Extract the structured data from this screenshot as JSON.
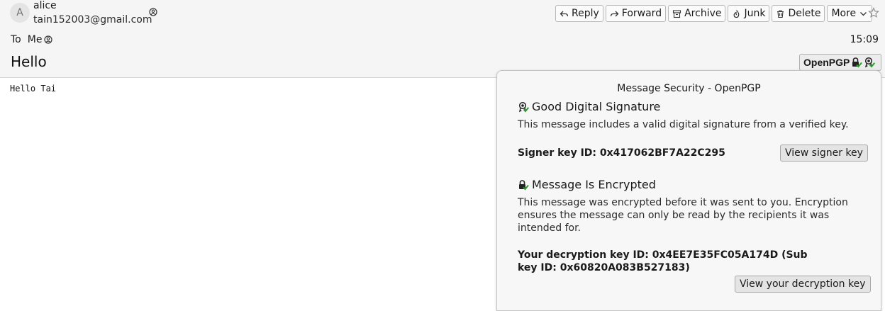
{
  "sender": {
    "avatar_letter": "A",
    "name": "alice",
    "email": "tain152003@gmail.com"
  },
  "toolbar": {
    "reply": "Reply",
    "forward": "Forward",
    "archive": "Archive",
    "junk": "Junk",
    "delete": "Delete",
    "more": "More"
  },
  "recipients": {
    "to_label": "To",
    "me": "Me"
  },
  "message": {
    "time": "15:09",
    "subject": "Hello",
    "body": "Hello Tai"
  },
  "security_button": {
    "label": "OpenPGP"
  },
  "security_popup": {
    "title": "Message Security - OpenPGP",
    "signature": {
      "heading": "Good Digital Signature",
      "description": "This message includes a valid digital signature from a verified key.",
      "key_line": "Signer key ID: 0x417062BF7A22C295",
      "button": "View signer key"
    },
    "encryption": {
      "heading": "Message Is Encrypted",
      "description": "This message was encrypted before it was sent to you. Encryption ensures the message can only be read by the recipients it was intended for.",
      "key_line": "Your decryption key ID: 0x4EE7E35FC05A174D (Sub key ID: 0x60820A083B527183)",
      "button": "View your decryption key"
    }
  },
  "icons": {
    "contact": "contact-icon",
    "star": "star-icon",
    "lock_check": "lock-check-icon",
    "signature_check": "signature-check-icon"
  },
  "colors": {
    "check_green": "#2a9d2a",
    "header_bg": "#f5f5f5",
    "popup_bg": "#f7f7f7"
  }
}
